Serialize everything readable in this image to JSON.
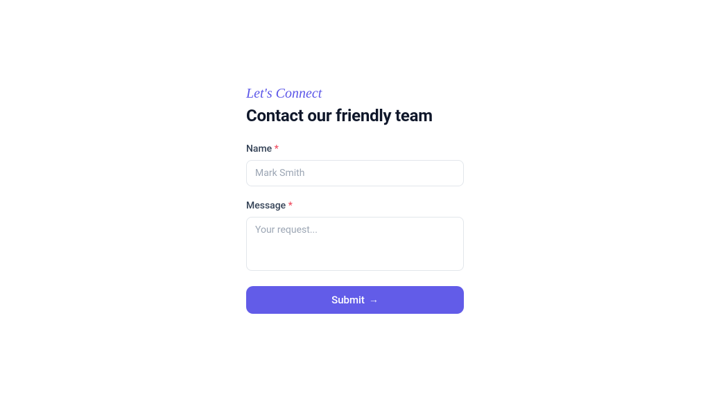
{
  "form": {
    "eyebrow": "Let's Connect",
    "heading": "Contact our friendly team",
    "name": {
      "label": "Name",
      "required_marker": "*",
      "placeholder": "Mark Smith",
      "value": ""
    },
    "message": {
      "label": "Message",
      "required_marker": "*",
      "placeholder": "Your request...",
      "value": ""
    },
    "submit": {
      "label": "Submit",
      "arrow": "→"
    }
  },
  "colors": {
    "accent": "#625ce8",
    "required": "#ef4a5e"
  }
}
